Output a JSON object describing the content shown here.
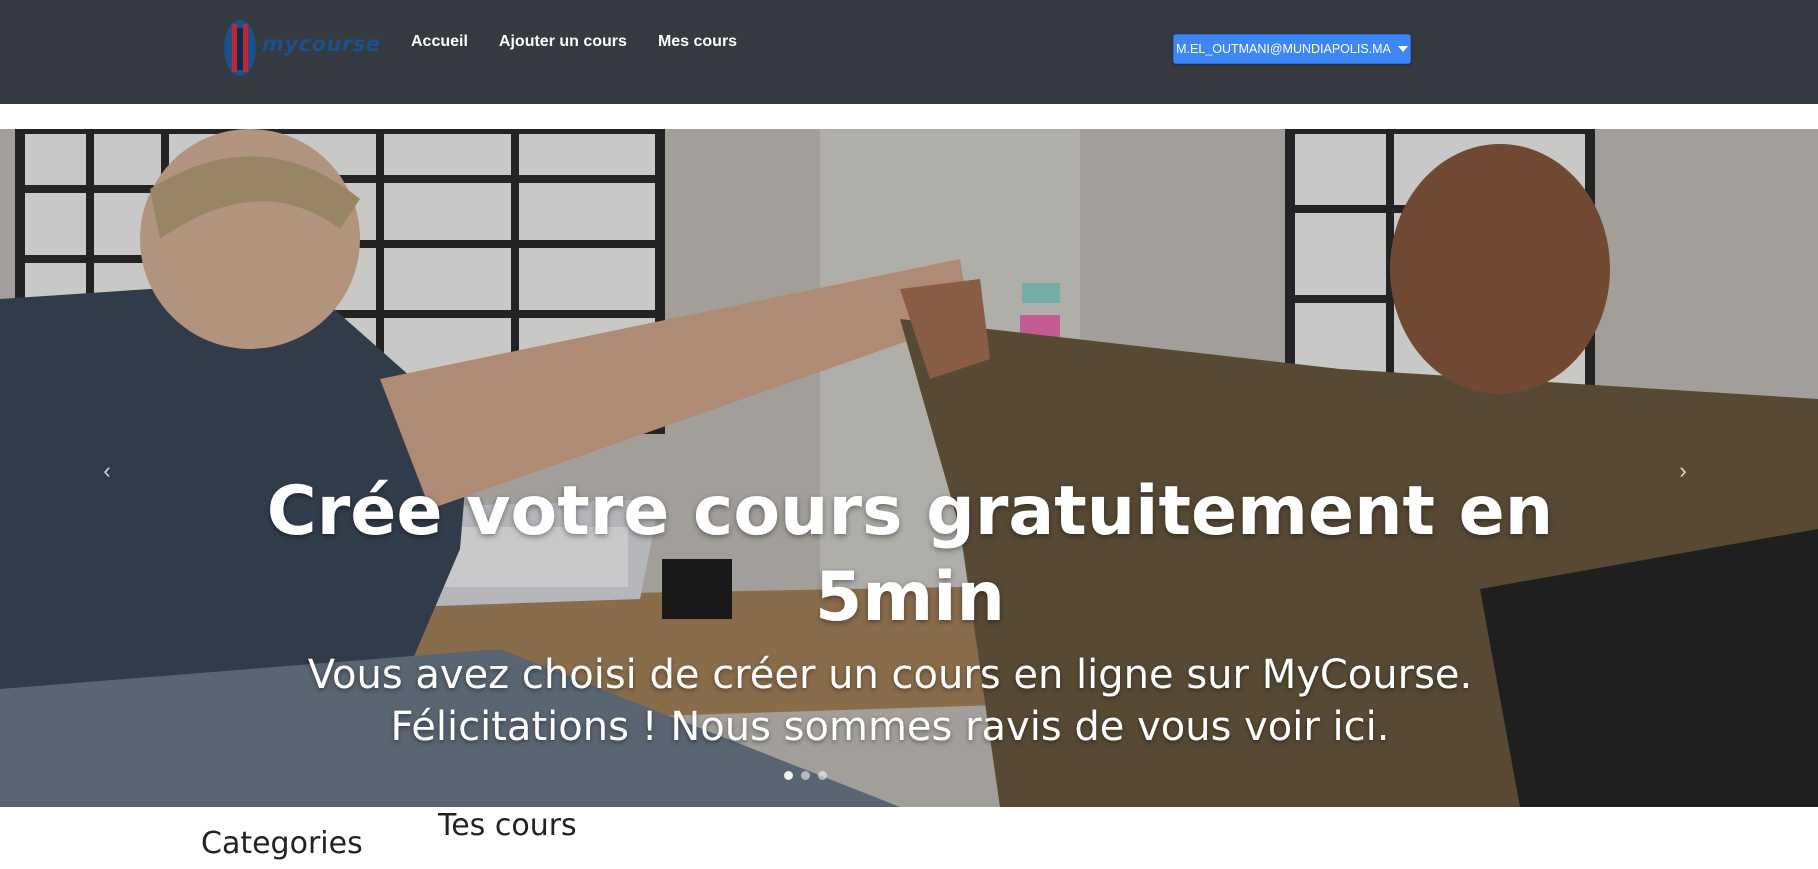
{
  "navbar": {
    "brand": "mycourse",
    "links": [
      "Accueil",
      "Ajouter un cours",
      "Mes cours"
    ],
    "user_email": "M.EL_OUTMANI@MUNDIAPOLIS.MA"
  },
  "hero": {
    "title": "Crée votre cours gratuitement en 5min",
    "subtitle": "Vous avez choisi de créer un cours en ligne sur MyCourse. Félicitations ! Nous sommes ravis de vous voir ici.",
    "slide_count": 3,
    "active_slide": 1
  },
  "sections": {
    "categories_title": "Categories",
    "courses_title": "Tes cours"
  },
  "colors": {
    "navbar_bg": "#343a40",
    "user_button": "#3d87f5"
  }
}
